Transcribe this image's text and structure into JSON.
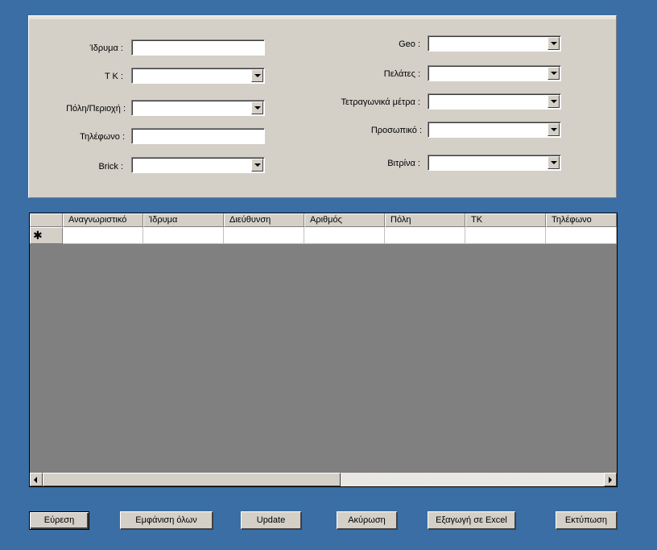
{
  "form": {
    "left": [
      {
        "label": "Ίδρυμα :",
        "type": "text"
      },
      {
        "label": "T K :",
        "type": "combo"
      },
      {
        "label": "Πόλη/Περιοχή :",
        "type": "combo"
      },
      {
        "label": "Τηλέφωνο :",
        "type": "text"
      },
      {
        "label": "Brick :",
        "type": "combo"
      }
    ],
    "right": [
      {
        "label": "Geo :",
        "type": "combo"
      },
      {
        "label": "Πελάτες :",
        "type": "combo"
      },
      {
        "label": "Τετραγωνικά μέτρα :",
        "type": "combo"
      },
      {
        "label": "Προσωπικό :",
        "type": "combo"
      },
      {
        "label": "Βιτρίνα :",
        "type": "combo"
      }
    ]
  },
  "grid": {
    "columns": [
      "Αναγνωριστικό",
      "Ίδρυμα",
      "Διεύθυνση",
      "Αριθμός",
      "Πόλη",
      "ΤΚ",
      "Τηλέφωνο"
    ],
    "new_row_marker": "✱"
  },
  "buttons": {
    "find": "Εύρεση",
    "show_all": "Εμφάνιση όλων",
    "update": "Update",
    "cancel": "Ακύρωση",
    "export_excel": "Εξαγωγή σε Excel",
    "print": "Εκτύπωση"
  }
}
